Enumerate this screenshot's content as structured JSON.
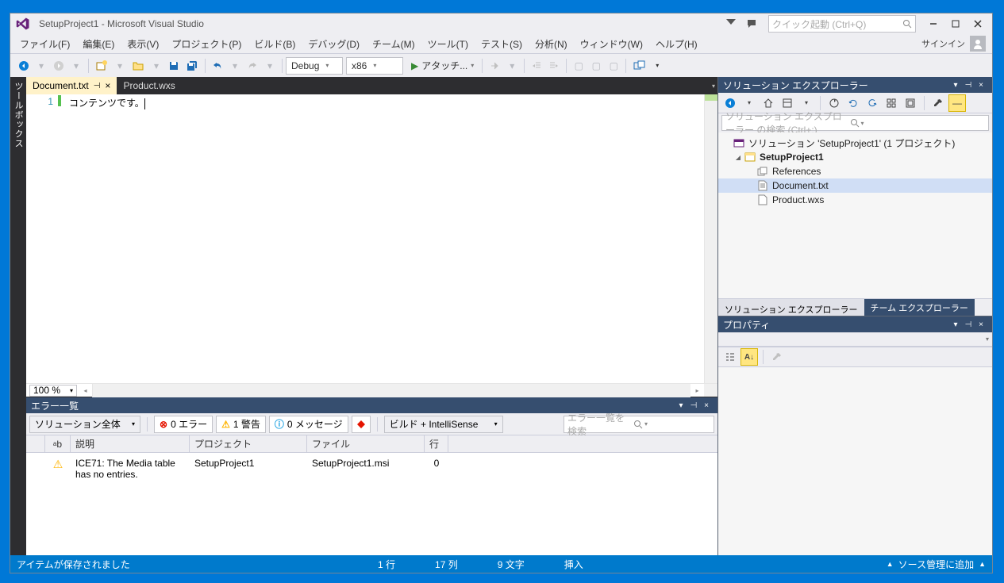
{
  "window": {
    "title": "SetupProject1 - Microsoft Visual Studio",
    "quick_launch_placeholder": "クイック起動 (Ctrl+Q)",
    "signin": "サインイン"
  },
  "menu": {
    "file": "ファイル(F)",
    "edit": "編集(E)",
    "view": "表示(V)",
    "project": "プロジェクト(P)",
    "build": "ビルド(B)",
    "debug": "デバッグ(D)",
    "team": "チーム(M)",
    "tools": "ツール(T)",
    "test": "テスト(S)",
    "analyze": "分析(N)",
    "window2": "ウィンドウ(W)",
    "help": "ヘルプ(H)"
  },
  "toolbar": {
    "config": "Debug",
    "platform": "x86",
    "start": "アタッチ..."
  },
  "left_tab": "ツールボックス",
  "tabs": {
    "active": "Document.txt",
    "inactive": "Product.wxs"
  },
  "editor": {
    "line_no": "1",
    "content": "コンテンツです。",
    "zoom": "100 %"
  },
  "error_list": {
    "title": "エラー一覧",
    "scope": "ソリューション全体",
    "errors": "0 エラー",
    "warnings": "1 警告",
    "messages": "0 メッセージ",
    "build_source": "ビルド + IntelliSense",
    "search_placeholder": "エラー一覧を検索",
    "columns": {
      "code": "",
      "desc": "説明",
      "project": "プロジェクト",
      "file": "ファイル",
      "line": "行"
    },
    "row": {
      "desc": "ICE71: The Media table has no entries.",
      "project": "SetupProject1",
      "file": "SetupProject1.msi",
      "line": "0"
    }
  },
  "solution_explorer": {
    "title": "ソリューション エクスプローラー",
    "search_placeholder": "ソリューション エクスプローラー の検索 (Ctrl+:)",
    "solution": "ソリューション 'SetupProject1' (1 プロジェクト)",
    "project": "SetupProject1",
    "references": "References",
    "file1": "Document.txt",
    "file2": "Product.wxs",
    "tab_active": "ソリューション エクスプローラー",
    "tab_inactive": "チーム エクスプローラー"
  },
  "properties": {
    "title": "プロパティ"
  },
  "statusbar": {
    "msg": "アイテムが保存されました",
    "line": "1 行",
    "col": "17 列",
    "char": "9 文字",
    "mode": "挿入",
    "source_control": "ソース管理に追加"
  }
}
